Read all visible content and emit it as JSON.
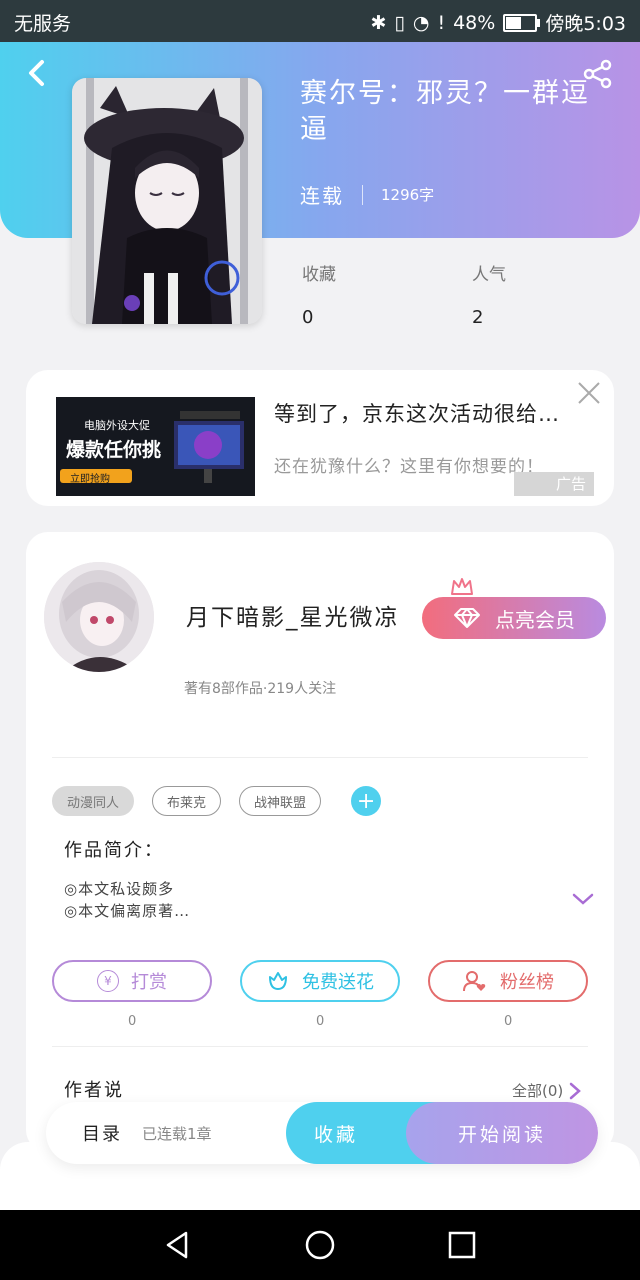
{
  "status_bar": {
    "carrier": "无服务",
    "battery_pct": "48%",
    "battery_level": 0.48,
    "time": "傍晚5:03"
  },
  "book": {
    "title": "赛尔号：邪灵？一群逗逼",
    "status": "连载",
    "word_count": "1296字",
    "favorites_label": "收藏",
    "favorites_value": "0",
    "popularity_label": "人气",
    "popularity_value": "2"
  },
  "ad": {
    "title": "等到了，京东这次活动很给…",
    "subtitle": "还在犹豫什么？这里有你想要的！",
    "badge": "广告",
    "image_text": {
      "brand": "电脑外设大促",
      "headline": "爆款任你挑",
      "cta": "立即抢购"
    }
  },
  "author": {
    "name": "月下暗影_星光微凉",
    "stats": "著有8部作品·219人关注",
    "vip_button": "点亮会员"
  },
  "tags": [
    "动漫同人",
    "布莱克",
    "战神联盟"
  ],
  "intro": {
    "title": "作品简介：",
    "lines": [
      "◎本文私设颇多",
      "◎本文偏离原著…"
    ]
  },
  "actions": {
    "reward": {
      "label": "打赏",
      "count": "0",
      "symbol": "¥"
    },
    "flower": {
      "label": "免费送花",
      "count": "0"
    },
    "fans": {
      "label": "粉丝榜",
      "count": "0"
    }
  },
  "author_say": {
    "title": "作者说",
    "all_link": "全部(0)"
  },
  "bottom_bar": {
    "toc": "目录",
    "toc_status": "已连载1章",
    "favorite": "收藏",
    "start_reading": "开始阅读"
  },
  "colors": {
    "accent_cyan": "#4fd0ee",
    "accent_purple": "#b893e6",
    "vip_pink": "#f26d7d",
    "reward_purple": "#b58ad8",
    "fans_red": "#e36c6c"
  }
}
